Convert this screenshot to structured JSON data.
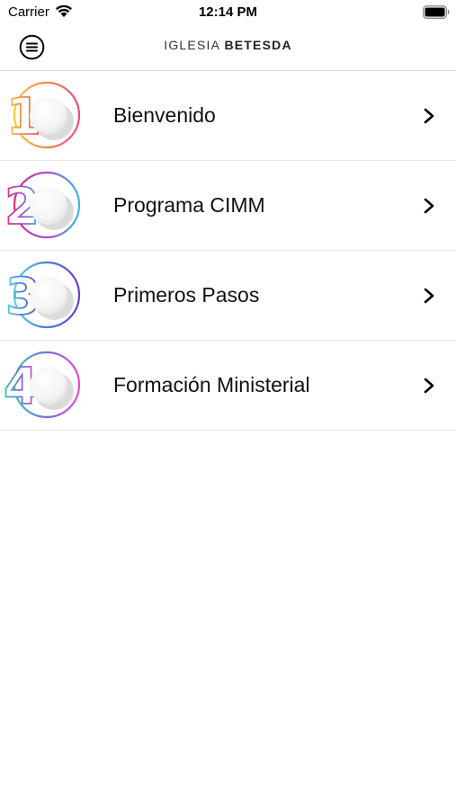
{
  "status_bar": {
    "carrier": "Carrier",
    "time": "12:14 PM"
  },
  "header": {
    "title_light": "IGLESIA",
    "title_bold": "BETESDA"
  },
  "items": [
    {
      "number": "1",
      "label": "Bienvenido",
      "colors": [
        "#f7c948",
        "#f48a4a",
        "#ea4c89"
      ]
    },
    {
      "number": "2",
      "label": "Programa CIMM",
      "colors": [
        "#e0307a",
        "#a64fd0",
        "#3fb8e0"
      ]
    },
    {
      "number": "3",
      "label": "Primeros Pasos",
      "colors": [
        "#5fd3e6",
        "#4a7fd8",
        "#6a3fc8"
      ]
    },
    {
      "number": "4",
      "label": "Formación Ministerial",
      "colors": [
        "#39c9a8",
        "#7a6fe0",
        "#e24ad6"
      ]
    }
  ]
}
